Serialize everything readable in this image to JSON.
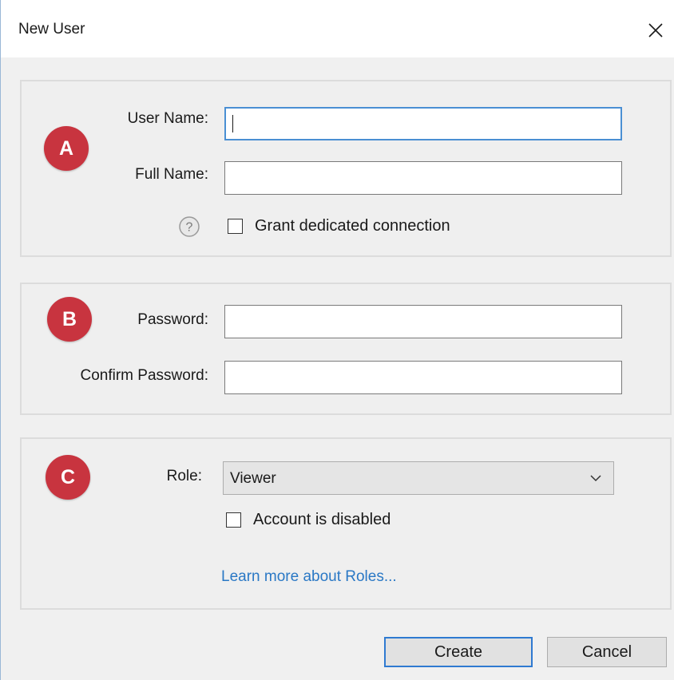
{
  "window": {
    "title": "New User"
  },
  "section_a": {
    "badge": "A",
    "user_name_label": "User Name:",
    "user_name_value": "",
    "full_name_label": "Full Name:",
    "full_name_value": "",
    "grant_label": "Grant dedicated connection",
    "grant_checked": false
  },
  "section_b": {
    "badge": "B",
    "password_label": "Password:",
    "password_value": "",
    "confirm_label": "Confirm Password:",
    "confirm_value": ""
  },
  "section_c": {
    "badge": "C",
    "role_label": "Role:",
    "role_value": "Viewer",
    "disabled_label": "Account is disabled",
    "disabled_checked": false,
    "learn_more": "Learn more about Roles..."
  },
  "buttons": {
    "create": "Create",
    "cancel": "Cancel"
  },
  "colors": {
    "badge": "#c8343f",
    "link": "#2a78c5",
    "focus": "#4a8fd3",
    "dialog_bg": "#f0f0f0"
  }
}
